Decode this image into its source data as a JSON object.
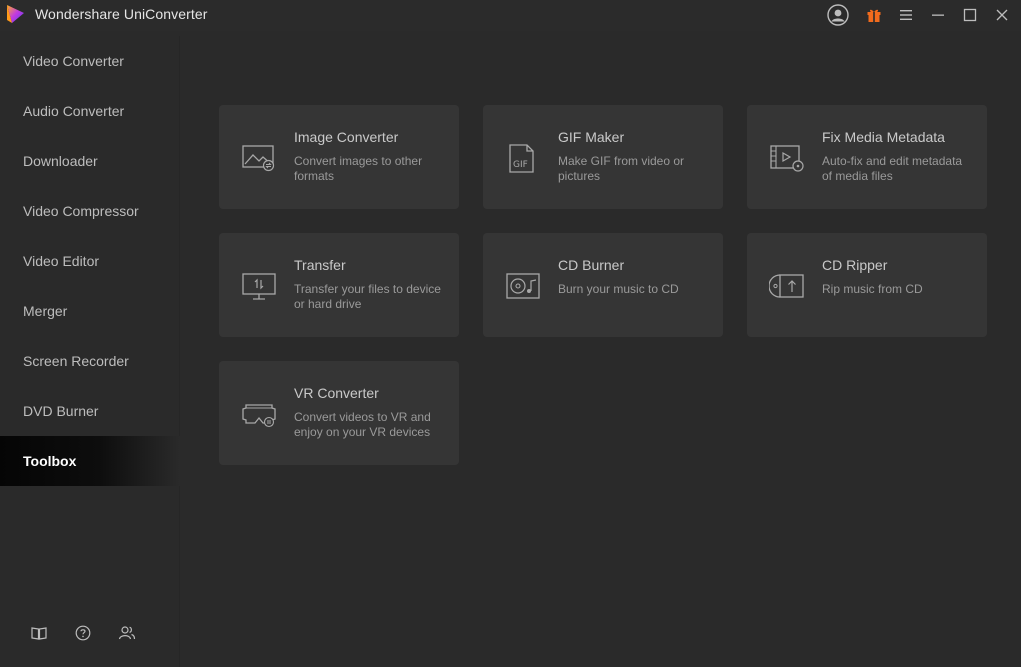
{
  "app": {
    "title": "Wondershare UniConverter",
    "accent_color": "#7b3fe4"
  },
  "titlebar": {
    "account_icon": "user-circle-icon",
    "gift_icon": "gift-icon",
    "menu_icon": "hamburger-menu-icon",
    "minimize_icon": "minimize-icon",
    "maximize_icon": "maximize-icon",
    "close_icon": "close-icon"
  },
  "sidebar": {
    "items": [
      {
        "label": "Video Converter"
      },
      {
        "label": "Audio Converter"
      },
      {
        "label": "Downloader"
      },
      {
        "label": "Video Compressor"
      },
      {
        "label": "Video Editor"
      },
      {
        "label": "Merger"
      },
      {
        "label": "Screen Recorder"
      },
      {
        "label": "DVD Burner"
      },
      {
        "label": "Toolbox",
        "active": true
      }
    ],
    "footer_icons": [
      "book-icon",
      "help-icon",
      "community-icon"
    ]
  },
  "toolbox": {
    "cards": [
      {
        "title": "Image Converter",
        "desc": "Convert images to other formats",
        "icon": "image-convert-icon"
      },
      {
        "title": "GIF Maker",
        "desc": "Make GIF from video or pictures",
        "icon": "gif-file-icon"
      },
      {
        "title": "Fix Media Metadata",
        "desc": "Auto-fix and edit metadata of media files",
        "icon": "metadata-icon"
      },
      {
        "title": "Transfer",
        "desc": "Transfer your files to device or hard drive",
        "icon": "transfer-icon"
      },
      {
        "title": "CD Burner",
        "desc": "Burn your music to CD",
        "icon": "cd-burner-icon"
      },
      {
        "title": "CD Ripper",
        "desc": "Rip music from CD",
        "icon": "cd-ripper-icon"
      },
      {
        "title": "VR Converter",
        "desc": "Convert videos to VR and enjoy on your VR devices",
        "icon": "vr-headset-icon"
      }
    ]
  }
}
